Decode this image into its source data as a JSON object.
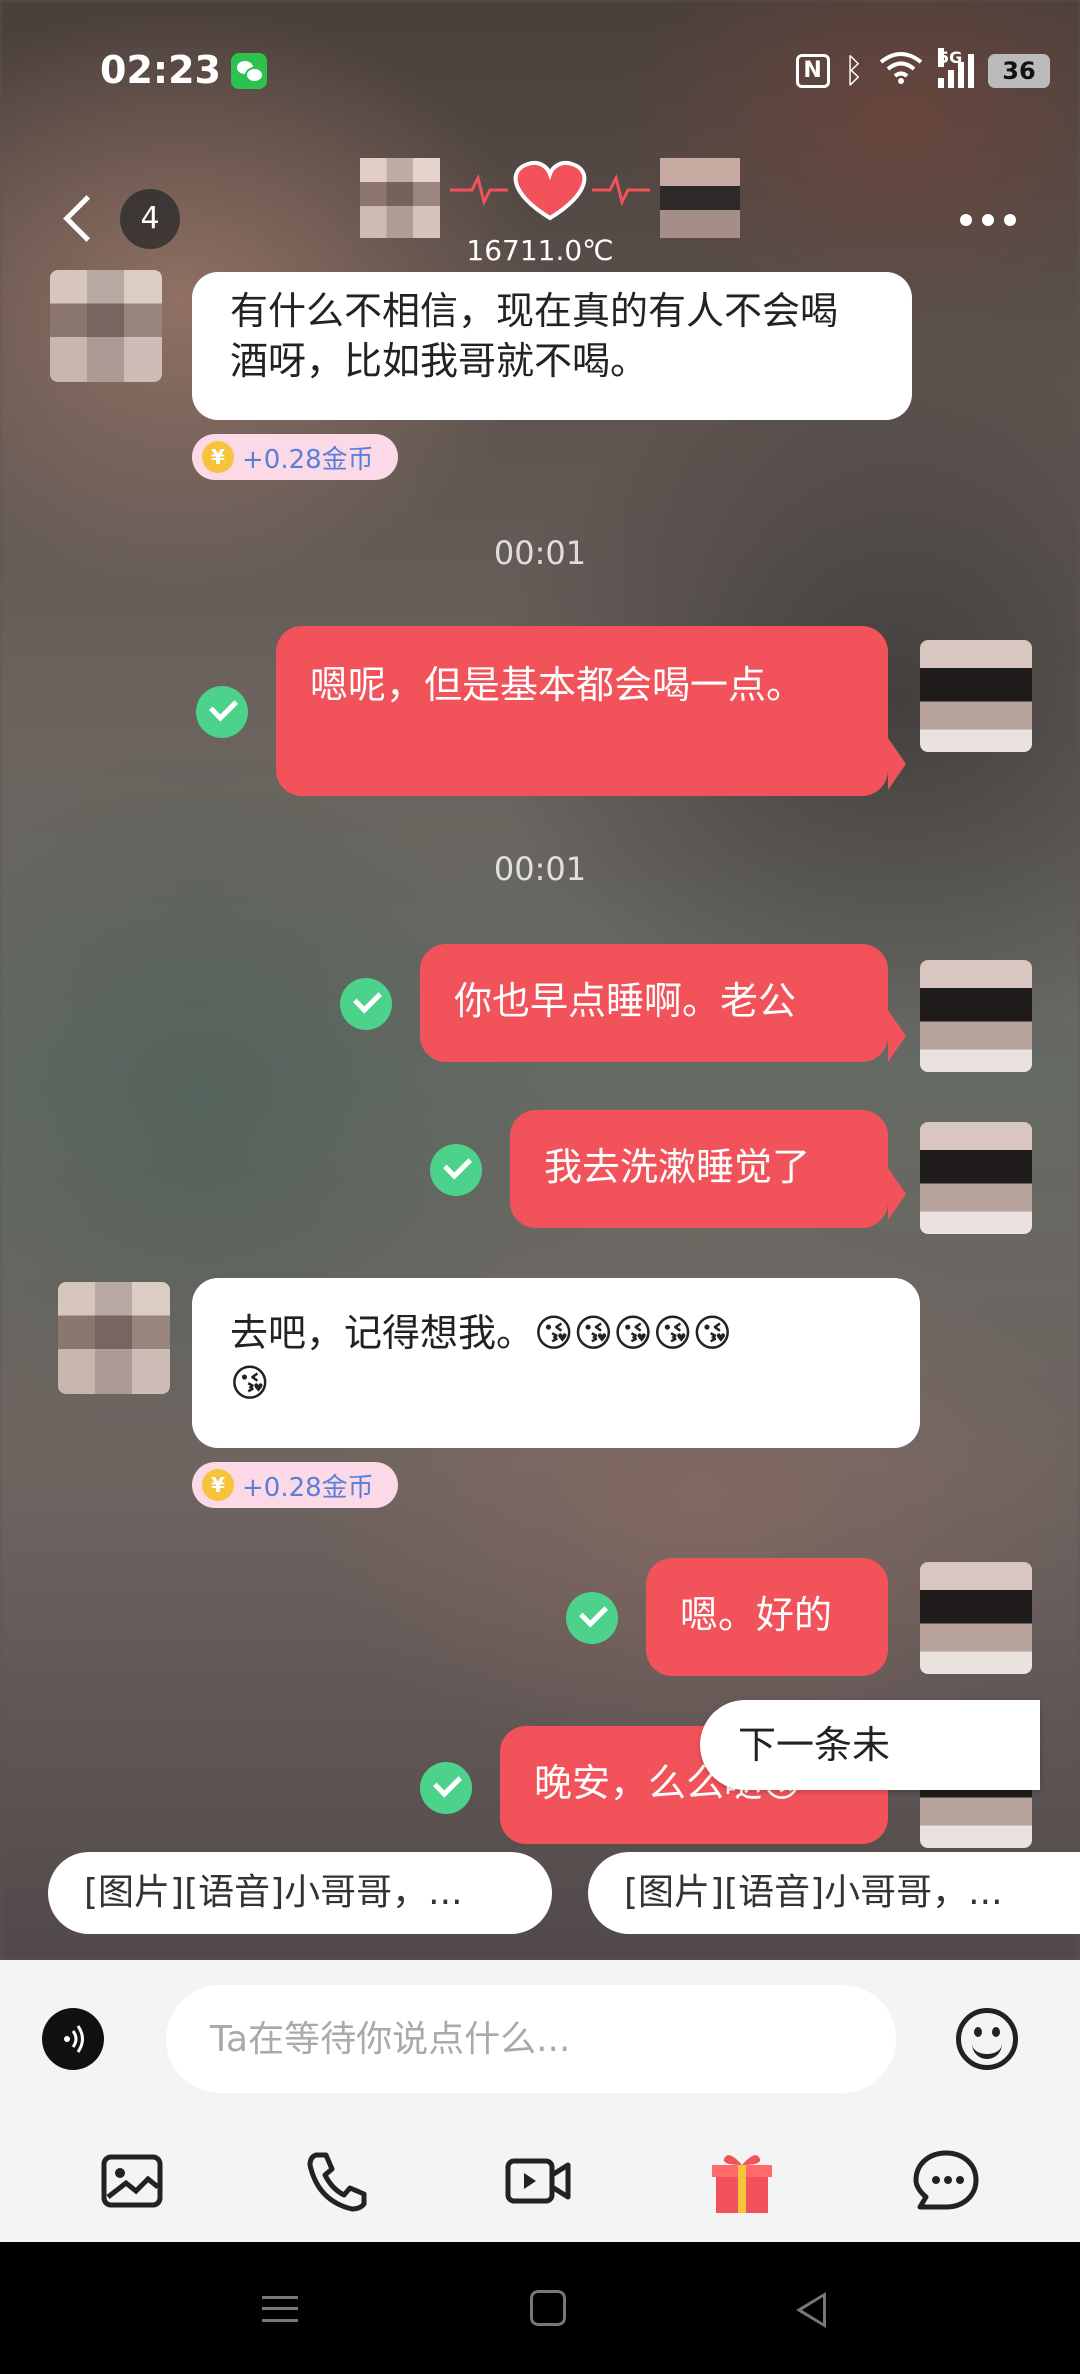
{
  "status_bar": {
    "time": "02:23",
    "battery": "36",
    "network": "5G"
  },
  "header": {
    "unread_count": "4",
    "temperature": "16711.0℃"
  },
  "messages": [
    {
      "side": "left",
      "text": "有什么不相信，现在真的有人不会喝酒呀，比如我哥就不喝。",
      "reward": "+0.28金币"
    },
    {
      "time": "00:01"
    },
    {
      "side": "right",
      "text": "嗯呢，但是基本都会喝一点。"
    },
    {
      "time": "00:01"
    },
    {
      "side": "right",
      "text": "你也早点睡啊。老公"
    },
    {
      "side": "right",
      "text": "我去洗漱睡觉了"
    },
    {
      "side": "left",
      "text": "去吧，记得想我。",
      "emojis": "😘😘😘😘😘",
      "emojis2": "😘",
      "reward": "+0.28金币"
    },
    {
      "side": "right",
      "text": "嗯。好的"
    },
    {
      "side": "right",
      "text": "晚安，么么哒",
      "emoji": "😘"
    }
  ],
  "coin_symbol": "¥",
  "next_unread_label": "下一条未",
  "quick_replies": [
    "[图片][语音]小哥哥，...",
    "[图片][语音]小哥哥，..."
  ],
  "input": {
    "placeholder": "Ta在等待你说点什么..."
  },
  "toolbar": {
    "icons": [
      "image-icon",
      "phone-icon",
      "video-call-icon",
      "gift-icon",
      "chat-bubble-icon"
    ]
  },
  "colors": {
    "sent_bubble": "#f2525a",
    "received_bubble": "#ffffff",
    "read_check": "#4dd28b",
    "gift": "#f2525a"
  }
}
